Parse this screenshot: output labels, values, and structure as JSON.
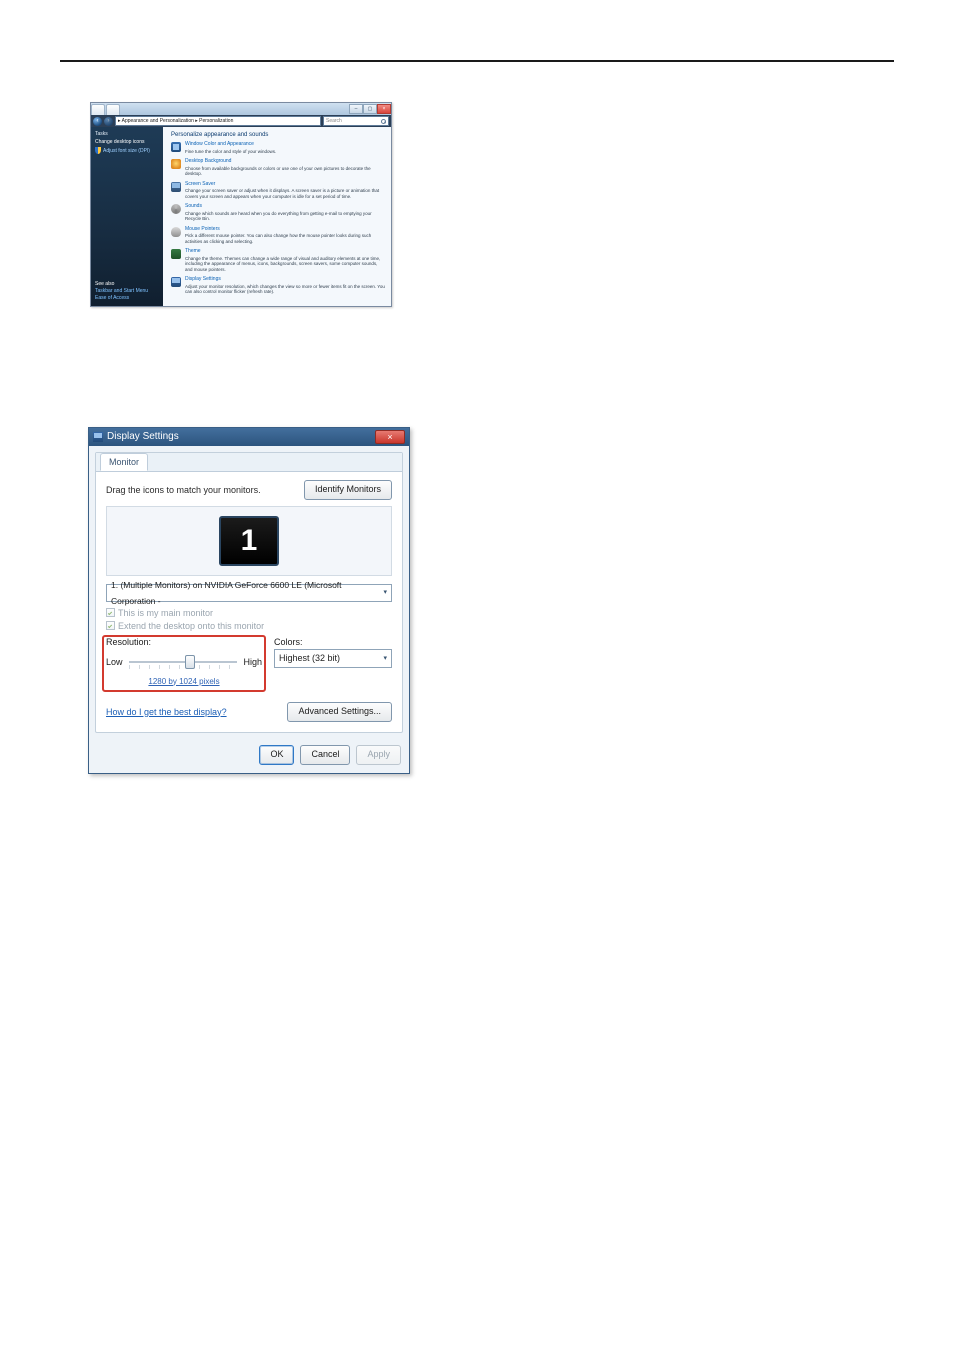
{
  "shot1": {
    "breadcrumb": "▸ Appearance and Personalization ▸ Personalization",
    "search_placeholder": "Search",
    "sidebar": {
      "heading": "Tasks",
      "items": [
        "Change desktop icons",
        "Adjust font size (DPI)"
      ],
      "footer_heading": "See also",
      "footer_links": [
        "Taskbar and Start Menu",
        "Ease of Access"
      ]
    },
    "main": {
      "title": "Personalize appearance and sounds",
      "items": [
        {
          "label": "Window Color and Appearance",
          "desc": "Fine tune the color and style of your windows."
        },
        {
          "label": "Desktop Background",
          "desc": "Choose from available backgrounds or colors or use one of your own pictures to decorate the desktop."
        },
        {
          "label": "Screen Saver",
          "desc": "Change your screen saver or adjust when it displays. A screen saver is a picture or animation that covers your screen and appears when your computer is idle for a set period of time."
        },
        {
          "label": "Sounds",
          "desc": "Change which sounds are heard when you do everything from getting e-mail to emptying your Recycle Bin."
        },
        {
          "label": "Mouse Pointers",
          "desc": "Pick a different mouse pointer. You can also change how the mouse pointer looks during such activities as clicking and selecting."
        },
        {
          "label": "Theme",
          "desc": "Change the theme. Themes can change a wide range of visual and auditory elements at one time, including the appearance of menus, icons, backgrounds, screen savers, some computer sounds, and mouse pointers."
        },
        {
          "label": "Display Settings",
          "desc": "Adjust your monitor resolution, which changes the view so more or fewer items fit on the screen. You can also control monitor flicker (refresh rate)."
        }
      ]
    }
  },
  "shot2": {
    "title": "Display Settings",
    "tab": "Monitor",
    "instruction": "Drag the icons to match your monitors.",
    "identify_btn": "Identify Monitors",
    "monitor_number": "1",
    "display_dropdown": "1. (Multiple Monitors) on NVIDIA GeForce 6600 LE (Microsoft Corporation -",
    "check_main": "This is my main monitor",
    "check_extend": "Extend the desktop onto this monitor",
    "resolution_label": "Resolution:",
    "slider_low": "Low",
    "slider_high": "High",
    "resolution_value": "1280 by 1024 pixels",
    "colors_label": "Colors:",
    "colors_value": "Highest (32 bit)",
    "help_link": "How do I get the best display?",
    "advanced_btn": "Advanced Settings...",
    "ok_btn": "OK",
    "cancel_btn": "Cancel",
    "apply_btn": "Apply"
  }
}
